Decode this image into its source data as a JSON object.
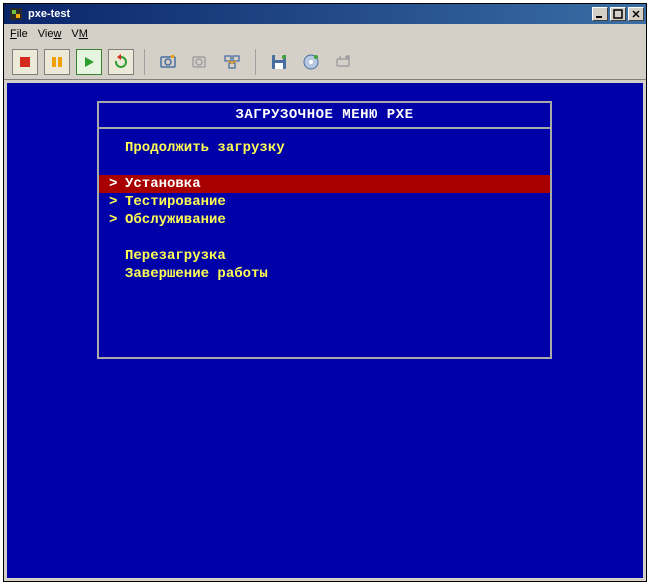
{
  "window": {
    "title": "pxe-test"
  },
  "menubar": {
    "file": "File",
    "view": "View",
    "vm": "VM"
  },
  "toolbar": {
    "stop": "stop",
    "pause": "pause",
    "play": "play",
    "restart": "restart",
    "snapshot": "snapshot",
    "revert": "revert",
    "manage": "manage",
    "floppy": "floppy",
    "cdrom": "cdrom",
    "network": "network"
  },
  "pxe": {
    "title": "ЗАГРУЗОЧНОЕ МЕНЮ PXE",
    "continue": "Продолжить загрузку",
    "install": "Установка",
    "testing": "Тестирование",
    "maintenance": "Обслуживание",
    "reboot": "Перезагрузка",
    "shutdown": "Завершение работы",
    "selected_index": 1
  },
  "colors": {
    "console_bg": "#0000a8",
    "menu_red": "#a80000",
    "menu_yellow": "#fefe54",
    "panel_border": "#aaa9aa"
  }
}
